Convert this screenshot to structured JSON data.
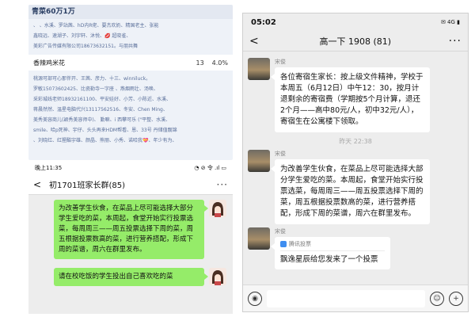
{
  "top_left": {
    "header": "青菜60万1万",
    "lines": [
      "、 、水溪、罗站茜、hD内R佬、要杰欢奶、精国老主、张能",
      "鑫晓远、速湖子、刘宇轩、沐悦、💋 超晓雀、",
      "美彩广告传媒有限公司18673632151。与朋共舞"
    ],
    "item": {
      "name": "香辣鸡米花",
      "count": "13",
      "percent": "4.0%"
    },
    "lines2": [
      "桃源可部可心那伴开、王茜、彦力、十三、winniluck。",
      "罗敏15073602425、比瓷勒寺一字座 、燕烟雨壮、汤唤、",
      "采彩城线老师18932161100、平安娃好、小芳、小陈近、水溪、",
      "蒋晨然然、温星电脑代兴13117562516、冬安、Chen Ming、",
      "美秀美容商儿(颖秀美容师中)、 勤嘛、i 西攀可乐 (\"平整、水溪、",
      "smile、哈p死神、宇仔、头头再来HDM帮看、恩、33号 丹储值靓锦",
      "、刘晓红、红猩酷宇雄、颜晶、熊丽、小秀、诺哈我💝、年少有为、"
    ]
  },
  "left_phone": {
    "time": "晚上11:35",
    "status_icons": "◔ ⊘ 令 .ıl ▭",
    "back": "<",
    "chat_title": "初1701班家长群(85)",
    "more": "···",
    "messages": [
      "为改善学生伙食，在菜品上尽可能选择大部分学生爱吃的菜，本周起，食堂开始实行投票选菜，每周周三——周五投票选择下周的菜，周五根据投票数高的菜，进行营养搭配，形成下周的菜谱，周六在群里发布。",
      "请在校吃饭的学生投出自己喜欢吃的菜"
    ]
  },
  "right_phone": {
    "time": "05:02",
    "status_right": "✉ 4G ▮",
    "back": "<",
    "chat_title": "高一下 1908 (81)",
    "more": "···",
    "messages": [
      {
        "sender": "宋俊",
        "text": "各位寄宿生家长：按上级文件精神，学校于本周五（6月12日）中午12：30，按月计退剩余的寄宿费（学期按5个月计算，退还2个月——高中80元/人，初中32元/人），寄宿生在公寓楼下领取。"
      },
      {
        "sender": "宋俊",
        "text": "为改善学生伙食，在菜品上尽可能选择大部分学生爱吃的菜。本周起，食堂开始实行投票选菜，每周周三——周五投票选择下周的菜，周五根据投票数高的菜，进行营养搭配，形成下周的菜谱，周六在群里发布。"
      }
    ],
    "timestamp": "昨天 22:38",
    "vote": {
      "sender": "宋俊",
      "source": "腾讯投票",
      "text": "飘逸星辰给您发来了一个投票"
    },
    "input_icons": {
      "voice": "◉",
      "emoji": "☺",
      "plus": "+"
    }
  }
}
